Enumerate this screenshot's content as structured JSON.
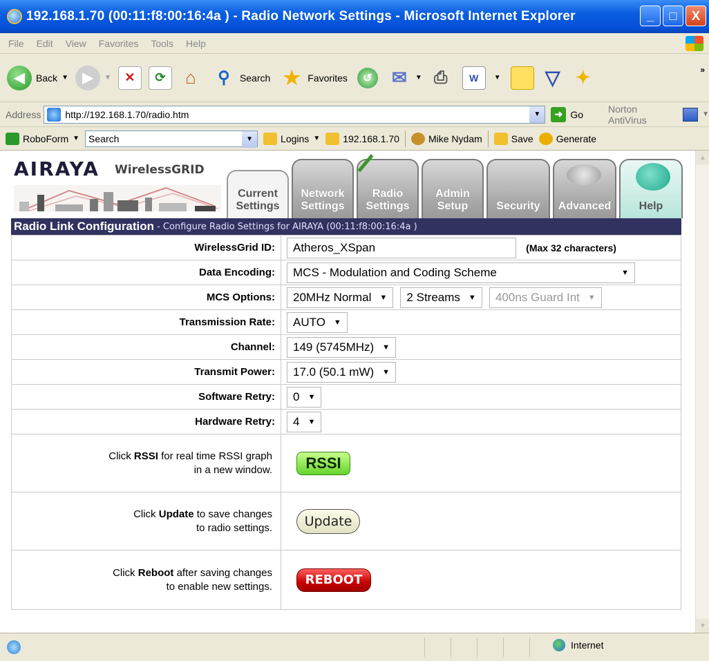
{
  "window": {
    "title": "192.168.1.70 (00:11:f8:00:16:4a ) - Radio Network Settings - Microsoft Internet Explorer",
    "buttons": [
      "_",
      "□",
      "X"
    ]
  },
  "menu": {
    "items": [
      "File",
      "Edit",
      "View",
      "Favorites",
      "Tools",
      "Help"
    ]
  },
  "toolbar": {
    "back": "Back",
    "search": "Search",
    "favorites": "Favorites"
  },
  "address": {
    "label": "Address",
    "url": "http://192.168.1.70/radio.htm",
    "go": "Go",
    "norton": "Norton AntiVirus"
  },
  "roboform": {
    "name": "RoboForm",
    "search_value": "Search",
    "logins": "Logins",
    "ip": "192.168.1.70",
    "user": "Mike Nydam",
    "save": "Save",
    "generate": "Generate"
  },
  "header": {
    "logo": "AIRAYA",
    "logo_sub": "WirelessGRID"
  },
  "tabs": [
    {
      "line1": "Current",
      "line2": "Settings"
    },
    {
      "line1": "Network",
      "line2": "Settings"
    },
    {
      "line1": "Radio",
      "line2": "Settings"
    },
    {
      "line1": "Admin",
      "line2": "Setup"
    },
    {
      "line1": "",
      "line2": "Security"
    },
    {
      "line1": "",
      "line2": "Advanced"
    },
    {
      "line1": "",
      "line2": "Help"
    }
  ],
  "config": {
    "title": "Radio Link Configuration",
    "subtitle": "- Configure Radio Settings for AIRAYA (00:11:f8:00:16:4a )",
    "rows": {
      "wirelessgrid_id": {
        "label": "WirelessGrid ID:",
        "value": "Atheros_XSpan",
        "hint": "(Max 32 characters)"
      },
      "data_encoding": {
        "label": "Data Encoding:",
        "value": "MCS - Modulation and Coding Scheme"
      },
      "mcs_options": {
        "label": "MCS Options:",
        "bandwidth": "20MHz Normal",
        "streams": "2 Streams",
        "guard": "400ns Guard Int"
      },
      "transmission_rate": {
        "label": "Transmission Rate:",
        "value": "AUTO"
      },
      "channel": {
        "label": "Channel:",
        "value": "149 (5745MHz)"
      },
      "transmit_power": {
        "label": "Transmit Power:",
        "value": "17.0 (50.1 mW)"
      },
      "software_retry": {
        "label": "Software Retry:",
        "value": "0"
      },
      "hardware_retry": {
        "label": "Hardware Retry:",
        "value": "4"
      }
    },
    "rssi": {
      "pre": "Click ",
      "bold": "RSSI",
      "post": " for real time RSSI graph",
      "line2": "in a new window.",
      "button": "RSSI"
    },
    "update": {
      "pre": "Click ",
      "bold": "Update",
      "post": " to save changes",
      "line2": "to radio settings.",
      "button": "Update"
    },
    "reboot": {
      "pre": "Click ",
      "bold": "Reboot",
      "post": " after saving changes",
      "line2": "to enable new settings.",
      "button": "REBOOT"
    }
  },
  "status": {
    "zone": "Internet"
  }
}
